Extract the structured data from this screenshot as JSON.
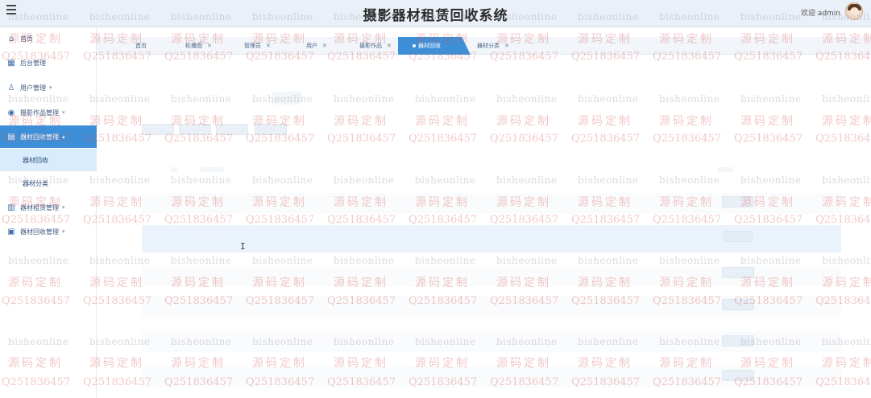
{
  "header": {
    "title": "摄影器材租赁回收系统",
    "welcome": "欢迎 admin"
  },
  "sidebar": {
    "items": [
      {
        "label": "首页",
        "icon": "home-icon"
      },
      {
        "label": "后台管理",
        "icon": "dashboard-icon"
      },
      {
        "label": "用户管理",
        "icon": "user-icon"
      },
      {
        "label": "摄影作品管理",
        "icon": "camera-icon"
      },
      {
        "label": "器材回收管理",
        "icon": "recycle-icon"
      },
      {
        "label": "器材租赁管理",
        "icon": "rent-icon"
      },
      {
        "label": "器材回收管理",
        "icon": "archive-icon"
      }
    ],
    "subitems": [
      {
        "label": "器材回收"
      },
      {
        "label": "器材分类"
      }
    ]
  },
  "tabs": [
    {
      "label": "首页"
    },
    {
      "label": "轮播图"
    },
    {
      "label": "管理员"
    },
    {
      "label": "用户"
    },
    {
      "label": "摄影作品"
    },
    {
      "label": "器材回收"
    },
    {
      "label": "器材分类"
    }
  ],
  "watermark": {
    "line1": "bisheonline",
    "line2": "源码定制",
    "line3": "Q2518364",
    "line3_full": "Q2518364 57"
  },
  "colors": {
    "accent": "#3d8fd8",
    "header_bg": "#eaf0f7",
    "submenu_bg": "#d9ecfb"
  }
}
